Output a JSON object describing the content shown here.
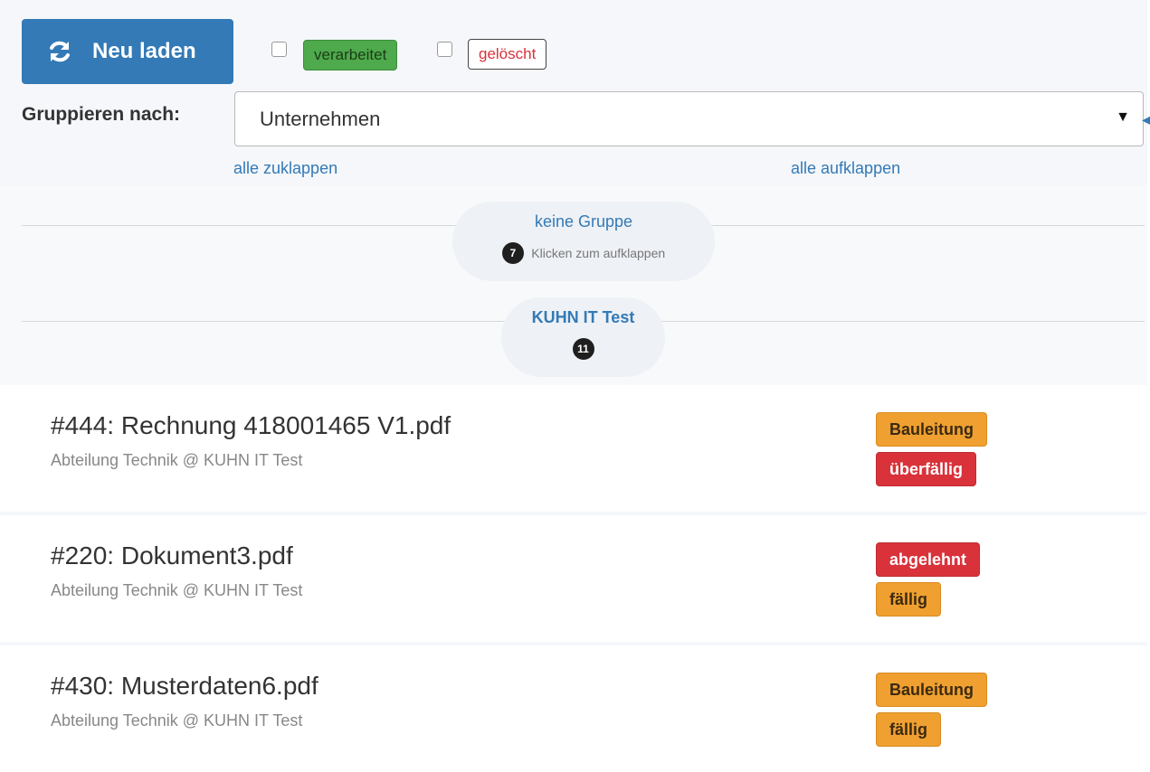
{
  "toolbar": {
    "reload_label": "Neu laden",
    "filter_processed_label": "verarbeitet",
    "filter_deleted_label": "gelöscht"
  },
  "grouping": {
    "label": "Gruppieren nach:",
    "selected": "Unternehmen",
    "collapse_all": "alle zuklappen",
    "expand_all": "alle aufklappen"
  },
  "groups": [
    {
      "title": "keine Gruppe",
      "count": "7",
      "hint": "Klicken zum aufklappen"
    },
    {
      "title": "KUHN IT Test",
      "count": "11"
    }
  ],
  "documents": [
    {
      "title": "#444: Rechnung 418001465 V1.pdf",
      "subtitle": "Abteilung Technik @ KUHN IT Test",
      "tags": [
        {
          "label": "Bauleitung",
          "color": "#f0a030"
        },
        {
          "label": "überfällig",
          "color": "#d9323b"
        }
      ]
    },
    {
      "title": "#220: Dokument3.pdf",
      "subtitle": "Abteilung Technik @ KUHN IT Test",
      "tags": [
        {
          "label": "abgelehnt",
          "color": "#d9323b"
        },
        {
          "label": "fällig",
          "color": "#f0a030"
        }
      ]
    },
    {
      "title": "#430: Musterdaten6.pdf",
      "subtitle": "Abteilung Technik @ KUHN IT Test",
      "tags": [
        {
          "label": "Bauleitung",
          "color": "#f0a030"
        },
        {
          "label": "fällig",
          "color": "#f0a030"
        }
      ]
    }
  ],
  "icons": {
    "reload": "refresh-icon",
    "select": "caret-down-icon"
  },
  "colors": {
    "primary": "#337ab7",
    "success": "#4fa94d",
    "danger": "#d9323b",
    "warning": "#f0a030"
  }
}
